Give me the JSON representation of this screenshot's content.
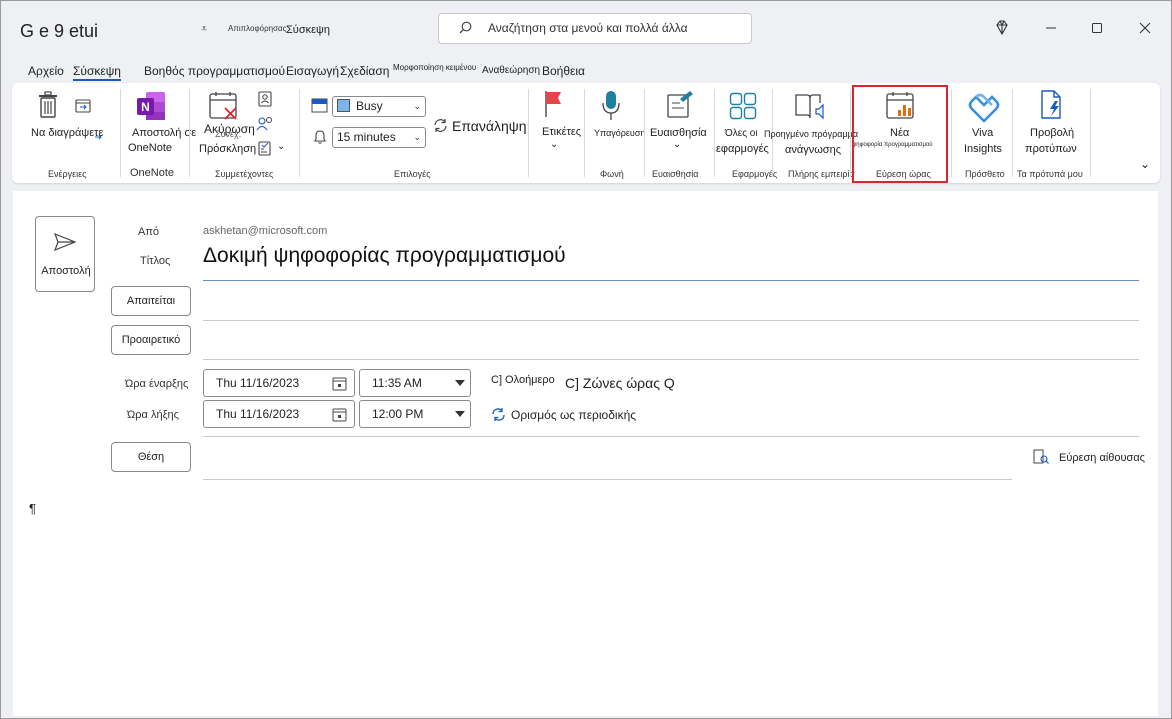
{
  "titlebar": {
    "app_title": "G e 9 etui",
    "qa_arrow": "⩡",
    "qa_small": "Απιπλοφόρησας",
    "qa_mode": "Σύσκεψη",
    "search_placeholder": "Αναζήτηση στα μενού και πολλά άλλα"
  },
  "tabs": {
    "file": "Αρχείο",
    "meeting": "Σύσκεψη",
    "scheduling_assistant": "Βοηθός προγραμματισμού",
    "insert": "Εισαγωγή",
    "draw": "Σχεδίαση",
    "format_text": "Μορφοποίηση κειμένου",
    "review": "Αναθεώρηση",
    "help": "Βοήθεια"
  },
  "ribbon": {
    "delete_label": "Να διαγράψετε",
    "actions_group": "Ενέργειες",
    "onenote_label_1": "Αποστολή σε",
    "onenote_label_2": "OneNote",
    "onenote_group": "OneNote",
    "cancel_label": "Ακύρωση",
    "cancel_overlay": "Συνεχ.",
    "invitation_label": "Πρόσκληση",
    "attendees_group": "Συμμετέχοντες",
    "show_as_value": "Busy",
    "reminder_value": "15 minutes",
    "recurrence_label": "Επανάληψη",
    "options_group": "Επιλογές",
    "tags_label": "Ετικέτες",
    "dictate_label": "Υπαγόρευση",
    "voice_group": "Φωνή",
    "sensitivity_label": "Ευαισθησία",
    "sensitivity_group": "Ευαισθησία",
    "all_apps_label_1": "Όλες οι",
    "all_apps_label_2": "εφαρμογές",
    "apps_group": "Εφαρμογές",
    "immersive_label_1": "Προηγμένο πρόγραμμα",
    "immersive_label_2": "ανάγνωσης",
    "immersive_group": "Πλήρης εμπειρία",
    "new_poll_label": "Νέα",
    "new_poll_sub": "ψηφοφορία προγραμματισμού",
    "find_time_group": "Εύρεση ώρας",
    "viva_label_1": "Viva",
    "viva_label_2": "Insights",
    "addin_group": "Πρόσθετο",
    "templates_label_1": "Προβολή",
    "templates_label_2": "προτύπων",
    "templates_group": "Τα πρότυπά μου"
  },
  "form": {
    "send_label": "Αποστολή",
    "from_label": "Από",
    "from_value": "askhetan@microsoft.com",
    "title_label": "Τίτλος",
    "subject": "Δοκιμή ψηφοφορίας προγραμματισμού",
    "required_label": "Απαιτείται",
    "optional_label": "Προαιρετικό",
    "start_label": "Ώρα έναρξης",
    "end_label": "Ώρα λήξης",
    "start_date": "Thu 11/16/2023",
    "start_time": "11:35 AM",
    "end_date": "Thu 11/16/2023",
    "end_time": "12:00 PM",
    "all_day_label": "C] Ολοήμερο",
    "time_zones_label": "C] Ζώνες ώρας Q",
    "make_recurring_label": "Ορισμός ως περιοδικής",
    "location_label": "Θέση",
    "room_finder_label": "Εύρεση αίθουσας",
    "body_mark": "¶"
  },
  "colors": {
    "accent": "#185abd",
    "highlight": "#d9262c",
    "onenote_purple": "#7719aa",
    "tags_red": "#e3454a",
    "teal": "#1f7ea1"
  }
}
